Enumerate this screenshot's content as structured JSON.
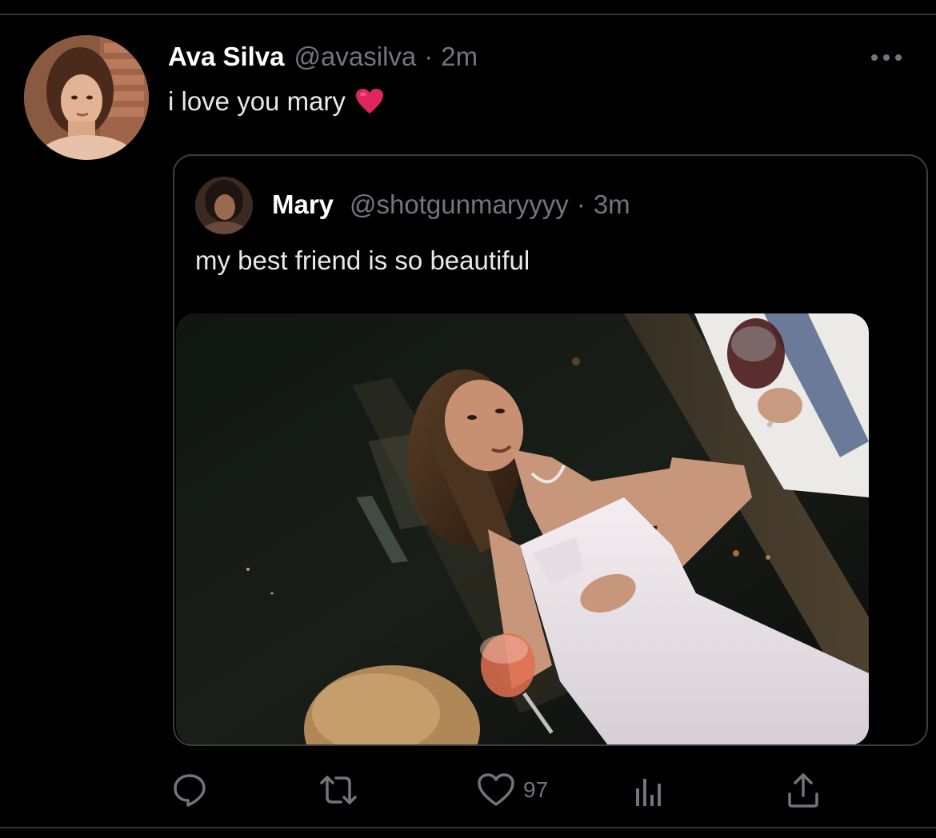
{
  "tweet": {
    "author_name": "Ava Silva",
    "author_handle": "@avasilva",
    "separator": "·",
    "time": "2m",
    "text": "i love you mary",
    "emoji": "red-heart",
    "more_icon": "more-horizontal-icon"
  },
  "quoted_tweet": {
    "author_name": "Mary",
    "author_handle": "@shotgunmaryyyy",
    "separator": "·",
    "time": "3m",
    "text": "my best friend is so beautiful",
    "media_description_icon": "photo"
  },
  "actions": {
    "reply_icon": "reply-icon",
    "retweet_icon": "retweet-icon",
    "like_icon": "heart-icon",
    "like_count": "97",
    "analytics_icon": "analytics-icon",
    "share_icon": "share-icon"
  },
  "colors": {
    "background": "#000000",
    "text_primary": "#e7e9ea",
    "text_secondary": "#71767b",
    "border": "#3a3d40",
    "heart_red": "#e0245e"
  }
}
